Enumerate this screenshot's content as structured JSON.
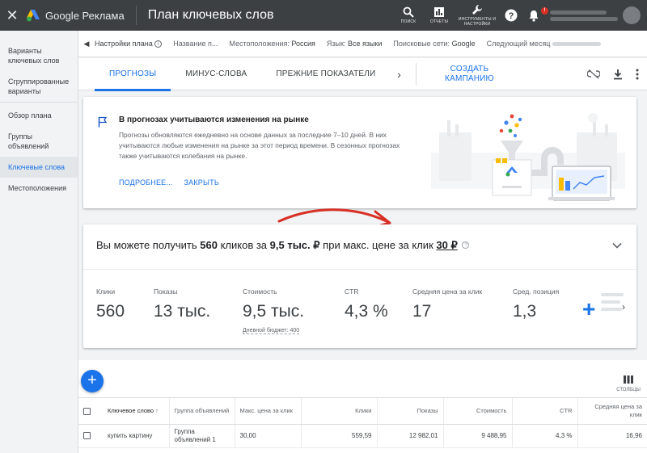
{
  "app": {
    "brand": "Google Реклама",
    "page_title": "План ключевых слов"
  },
  "topbar": {
    "search_caption": "ПОИСК",
    "reports_caption": "ОТЧЕТЫ",
    "tools_caption": "ИНСТРУМЕНТЫ И НАСТРОЙКИ",
    "notification_badge": "!"
  },
  "sidebar": {
    "items": [
      {
        "label": "Варианты ключевых слов"
      },
      {
        "label": "Сгруппированные варианты"
      },
      {
        "label": "Обзор плана"
      },
      {
        "label": "Группы объявлений"
      },
      {
        "label": "Ключевые слова"
      },
      {
        "label": "Местоположения"
      }
    ]
  },
  "settings": {
    "plan_label": "Настройки плана",
    "name_label": "Название п...",
    "locations_label": "Местоположения:",
    "locations_value": "Россия",
    "language_label": "Язык:",
    "language_value": "Все языки",
    "network_label": "Поисковые сети:",
    "network_value": "Google",
    "period_label": "Следующий месяц"
  },
  "tabs": {
    "items": [
      {
        "label": "ПРОГНОЗЫ"
      },
      {
        "label": "МИНУС-СЛОВА"
      },
      {
        "label": "ПРЕЖНИЕ ПОКАЗАТЕЛИ"
      }
    ],
    "create_campaign": "СОЗДАТЬ КАМПАНИЮ"
  },
  "info_card": {
    "title": "В прогнозах учитываются изменения на рынке",
    "body": "Прогнозы обновляются ежедневно на основе данных за последние 7–10 дней. В них учитываются любые изменения на рынке за этот период времени. В сезонных прогнозах также учитываются колебания на рынке.",
    "learn_more": "ПОДРОБНЕЕ...",
    "close": "ЗАКРЫТЬ"
  },
  "forecast": {
    "head_pre": "Вы можете получить",
    "clicks": "560",
    "head_mid1": "кликов за",
    "cost": "9,5 тыс. ₽",
    "head_mid2": "при макс. цене за клик",
    "max_cpc": "30 ₽",
    "help": "?",
    "metrics": {
      "clicks_label": "Клики",
      "clicks_value": "560",
      "impr_label": "Показы",
      "impr_value": "13 тыс.",
      "cost_label": "Стоимость",
      "cost_value": "9,5 тыс.",
      "budget_label": "Дневной бюджет: 400",
      "ctr_label": "CTR",
      "ctr_value": "4,3 %",
      "avg_cpc_label": "Средняя цена за клик",
      "avg_cpc_value": "17",
      "avg_pos_label": "Сред. позиция",
      "avg_pos_value": "1,3"
    }
  },
  "table": {
    "columns_caption": "СТОЛБЦЫ",
    "headers": {
      "keyword": "Ключевое слово",
      "ad_group": "Группа объявлений",
      "max_cpc": "Макс. цена за клик",
      "clicks": "Клики",
      "impressions": "Показы",
      "cost": "Стоимость",
      "ctr": "CTR",
      "avg_cpc": "Средняя цена за клик"
    },
    "rows": [
      {
        "keyword": "купить картину",
        "ad_group": "Группа объявлений 1",
        "max_cpc": "30,00",
        "clicks": "559,59",
        "impressions": "12 982,01",
        "cost": "9 488,95",
        "ctr": "4,3 %",
        "avg_cpc": "16,96"
      }
    ]
  },
  "colors": {
    "accent": "#1a73e8",
    "topbar": "#3c4043",
    "annotation_arrow": "#d93025"
  }
}
